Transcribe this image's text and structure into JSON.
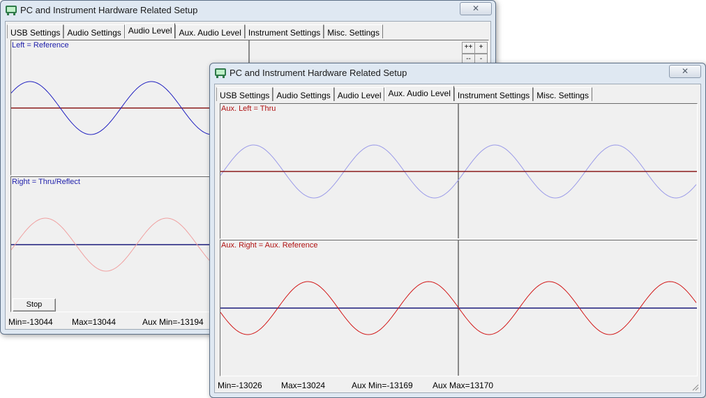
{
  "back_window": {
    "title": "PC and Instrument Hardware Related Setup",
    "close_label": "✕",
    "tabs": [
      "USB Settings",
      "Audio Settings",
      "Audio Level",
      "Aux. Audio Level",
      "Instrument Settings",
      "Misc. Settings"
    ],
    "active_tab": "Audio Level",
    "zoom_buttons": [
      "++",
      "+",
      "--",
      "-"
    ],
    "left_plot_label": "Left = Reference",
    "right_plot_label": "Right = Thru/Reflect",
    "stop_label": "Stop",
    "status": {
      "min": "Min=-13044",
      "max": "Max=13044",
      "aux_min": "Aux Min=-13194"
    }
  },
  "front_window": {
    "title": "PC and Instrument Hardware Related Setup",
    "close_label": "✕",
    "tabs": [
      "USB Settings",
      "Audio Settings",
      "Audio Level",
      "Aux. Audio Level",
      "Instrument Settings",
      "Misc. Settings"
    ],
    "active_tab": "Aux. Audio Level",
    "aux_left_label": "Aux. Left = Thru",
    "aux_right_label": "Aux. Right = Aux. Reference",
    "status": {
      "min": "Min=-13026",
      "max": "Max=13024",
      "aux_min": "Aux Min=-13169",
      "aux_max": "Aux Max=13170"
    }
  },
  "colors": {
    "label_blue": "#1d1daa",
    "label_red": "#b01010",
    "blue_wave": "#2020c0",
    "light_blue_wave": "#9a9ae8",
    "red_wave": "#d21818",
    "pink_wave": "#f0a0a0",
    "dark_red_axis": "#8b1a1a",
    "dark_blue_axis": "#1a1a7a"
  }
}
